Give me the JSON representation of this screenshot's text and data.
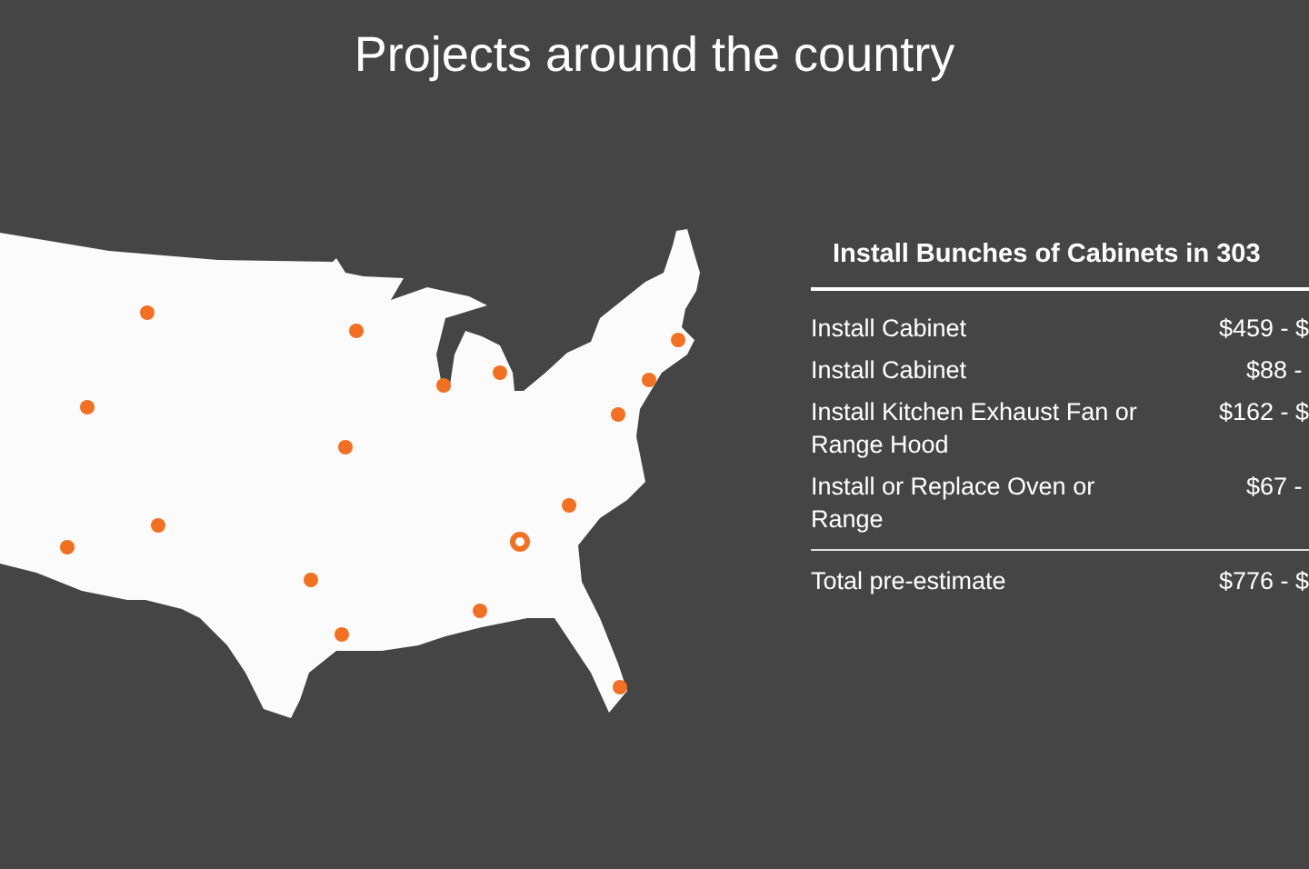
{
  "heading": "Projects around the country",
  "map": {
    "pins": [
      {
        "selected": false
      },
      {
        "selected": false
      },
      {
        "selected": false
      },
      {
        "selected": false
      },
      {
        "selected": false
      },
      {
        "selected": false
      },
      {
        "selected": false
      },
      {
        "selected": false
      },
      {
        "selected": false
      },
      {
        "selected": false
      },
      {
        "selected": false
      },
      {
        "selected": false
      },
      {
        "selected": true
      },
      {
        "selected": false
      },
      {
        "selected": false
      },
      {
        "selected": false
      },
      {
        "selected": false
      }
    ]
  },
  "estimate": {
    "title": "Install Bunches of Cabinets in 303",
    "rows": [
      {
        "task": "Install Cabinet",
        "price": "$459 - $"
      },
      {
        "task": "Install Cabinet",
        "price": "$88 - "
      },
      {
        "task": "Install Kitchen Exhaust Fan or Range Hood",
        "price": "$162 - $"
      },
      {
        "task": "Install or Replace Oven or Range",
        "price": "$67 - "
      }
    ],
    "total": {
      "label": "Total pre-estimate",
      "price": "$776 - $"
    }
  }
}
